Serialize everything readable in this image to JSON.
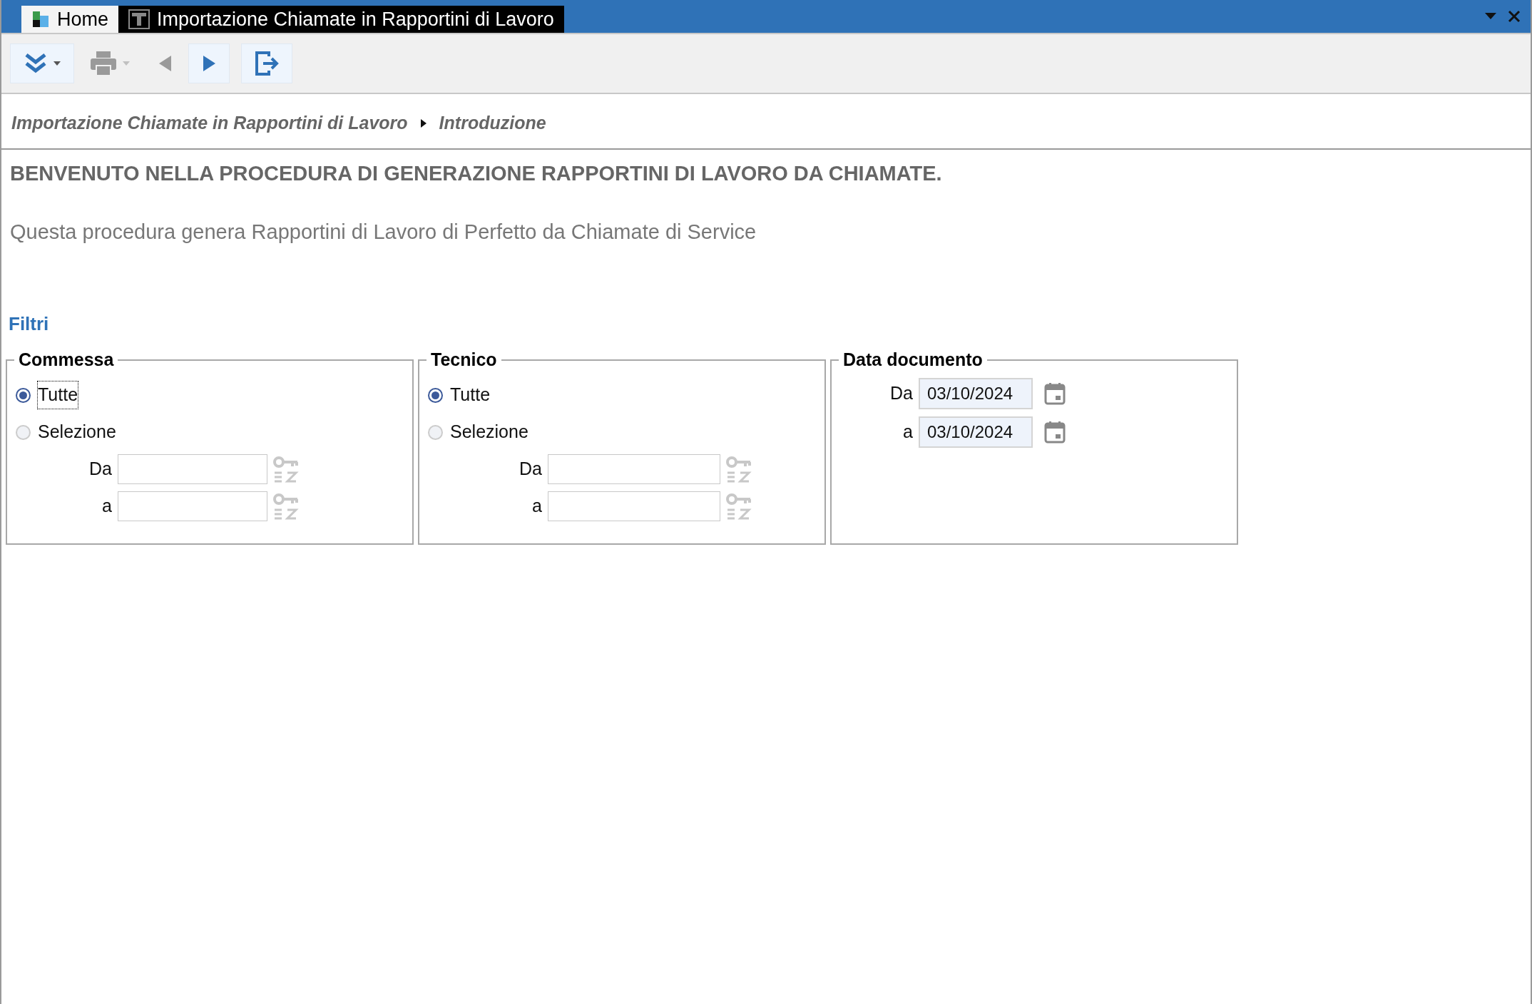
{
  "window": {
    "tabs": [
      {
        "label": "Home",
        "kind": "home",
        "selected": false
      },
      {
        "label": "Importazione Chiamate in Rapportini di Lavoro",
        "kind": "report",
        "selected": true
      }
    ]
  },
  "toolbar": [
    {
      "kind": "chevrons",
      "disabled": false,
      "dropdown": true
    },
    {
      "kind": "print",
      "disabled": true,
      "dropdown": true
    },
    {
      "kind": "back",
      "disabled": true,
      "dropdown": false
    },
    {
      "kind": "forward",
      "disabled": false,
      "dropdown": false
    },
    {
      "kind": "exit",
      "disabled": false,
      "dropdown": false
    }
  ],
  "breadcrumb": [
    "Importazione Chiamate in Rapportini di Lavoro",
    "Introduzione"
  ],
  "heading": "BENVENUTO NELLA PROCEDURA DI GENERAZIONE RAPPORTINI DI LAVORO DA CHIAMATE.",
  "description": "Questa procedura genera Rapportini di Lavoro di Perfetto da Chiamate di Service",
  "filters": {
    "title": "Filtri",
    "groups": [
      {
        "kind": "selection",
        "title": "Commessa",
        "options": [
          {
            "label": "Tutte",
            "selected": true,
            "focused": true
          },
          {
            "label": "Selezione",
            "selected": false,
            "focused": false
          }
        ],
        "fields": [
          {
            "label": "Da"
          },
          {
            "label": "a"
          }
        ]
      },
      {
        "kind": "selection",
        "title": "Tecnico",
        "options": [
          {
            "label": "Tutte",
            "selected": true,
            "focused": false
          },
          {
            "label": "Selezione",
            "selected": false,
            "focused": false
          }
        ],
        "fields": [
          {
            "label": "Da"
          },
          {
            "label": "a"
          }
        ]
      },
      {
        "kind": "dates",
        "title": "Data documento",
        "fields": [
          {
            "label": "Da",
            "value": "03/10/2024"
          },
          {
            "label": "a",
            "value": "03/10/2024"
          }
        ]
      }
    ]
  }
}
